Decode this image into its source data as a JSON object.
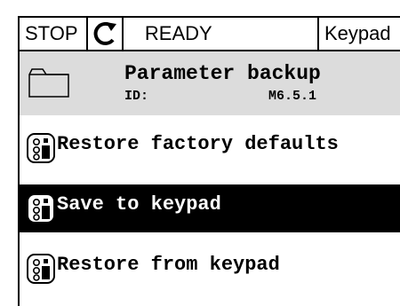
{
  "status_bar": {
    "state": "STOP",
    "rotation_icon": "rotation-arrow-icon",
    "ready": "READY",
    "control_place": "Keypad"
  },
  "header": {
    "folder_icon": "folder-icon",
    "title": "Parameter backup",
    "id_label": "ID:",
    "id_value": "M6.5.1"
  },
  "menu": {
    "items": [
      {
        "label": "Restore factory defaults",
        "icon": "parameter-icon",
        "selected": false
      },
      {
        "label": "Save to keypad",
        "icon": "parameter-icon",
        "selected": true
      },
      {
        "label": "Restore from keypad",
        "icon": "parameter-icon",
        "selected": false
      }
    ]
  }
}
